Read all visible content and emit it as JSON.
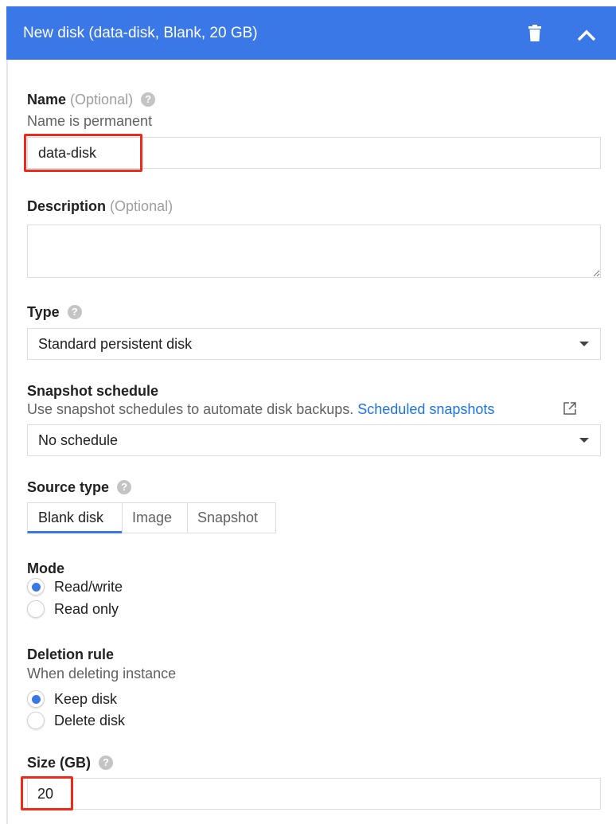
{
  "header": {
    "title": "New disk (data-disk, Blank, 20 GB)",
    "color": "#3b78e7",
    "delete_icon": "trash-icon",
    "collapse_icon": "chevron-up-icon"
  },
  "name": {
    "label": "Name",
    "optional": "(Optional)",
    "helper": "Name is permanent",
    "value": "data-disk"
  },
  "description": {
    "label": "Description",
    "optional": "(Optional)",
    "value": ""
  },
  "type": {
    "label": "Type",
    "value": "Standard persistent disk"
  },
  "snapshot": {
    "label": "Snapshot schedule",
    "helper": "Use snapshot schedules to automate disk backups.",
    "link": "Scheduled snapshots",
    "value": "No schedule"
  },
  "source": {
    "label": "Source type",
    "tabs": [
      "Blank disk",
      "Image",
      "Snapshot"
    ],
    "selected": "Blank disk"
  },
  "mode": {
    "label": "Mode",
    "options": [
      "Read/write",
      "Read only"
    ],
    "selected": "Read/write"
  },
  "deletion": {
    "label": "Deletion rule",
    "helper": "When deleting instance",
    "options": [
      "Keep disk",
      "Delete disk"
    ],
    "selected": "Keep disk"
  },
  "size": {
    "label": "Size (GB)",
    "value": "20"
  },
  "help_glyph": "?"
}
